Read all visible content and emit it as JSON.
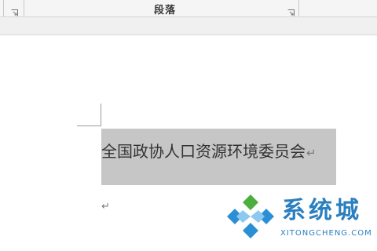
{
  "ribbon": {
    "group_label": "段落",
    "launcher_icon": "dialog-launcher-icon"
  },
  "document": {
    "selected_text": "全国政协人口资源环境委员会",
    "paragraph_mark": "↵",
    "empty_paragraph_mark": "↵",
    "selection_color": "#c6c6c6"
  },
  "watermark": {
    "title": "系统城",
    "url": "XITONGCHENG.COM",
    "brand_color": "#2a7fbf",
    "logo_colors": [
      "#4cae3d",
      "#2b8fd6"
    ]
  }
}
